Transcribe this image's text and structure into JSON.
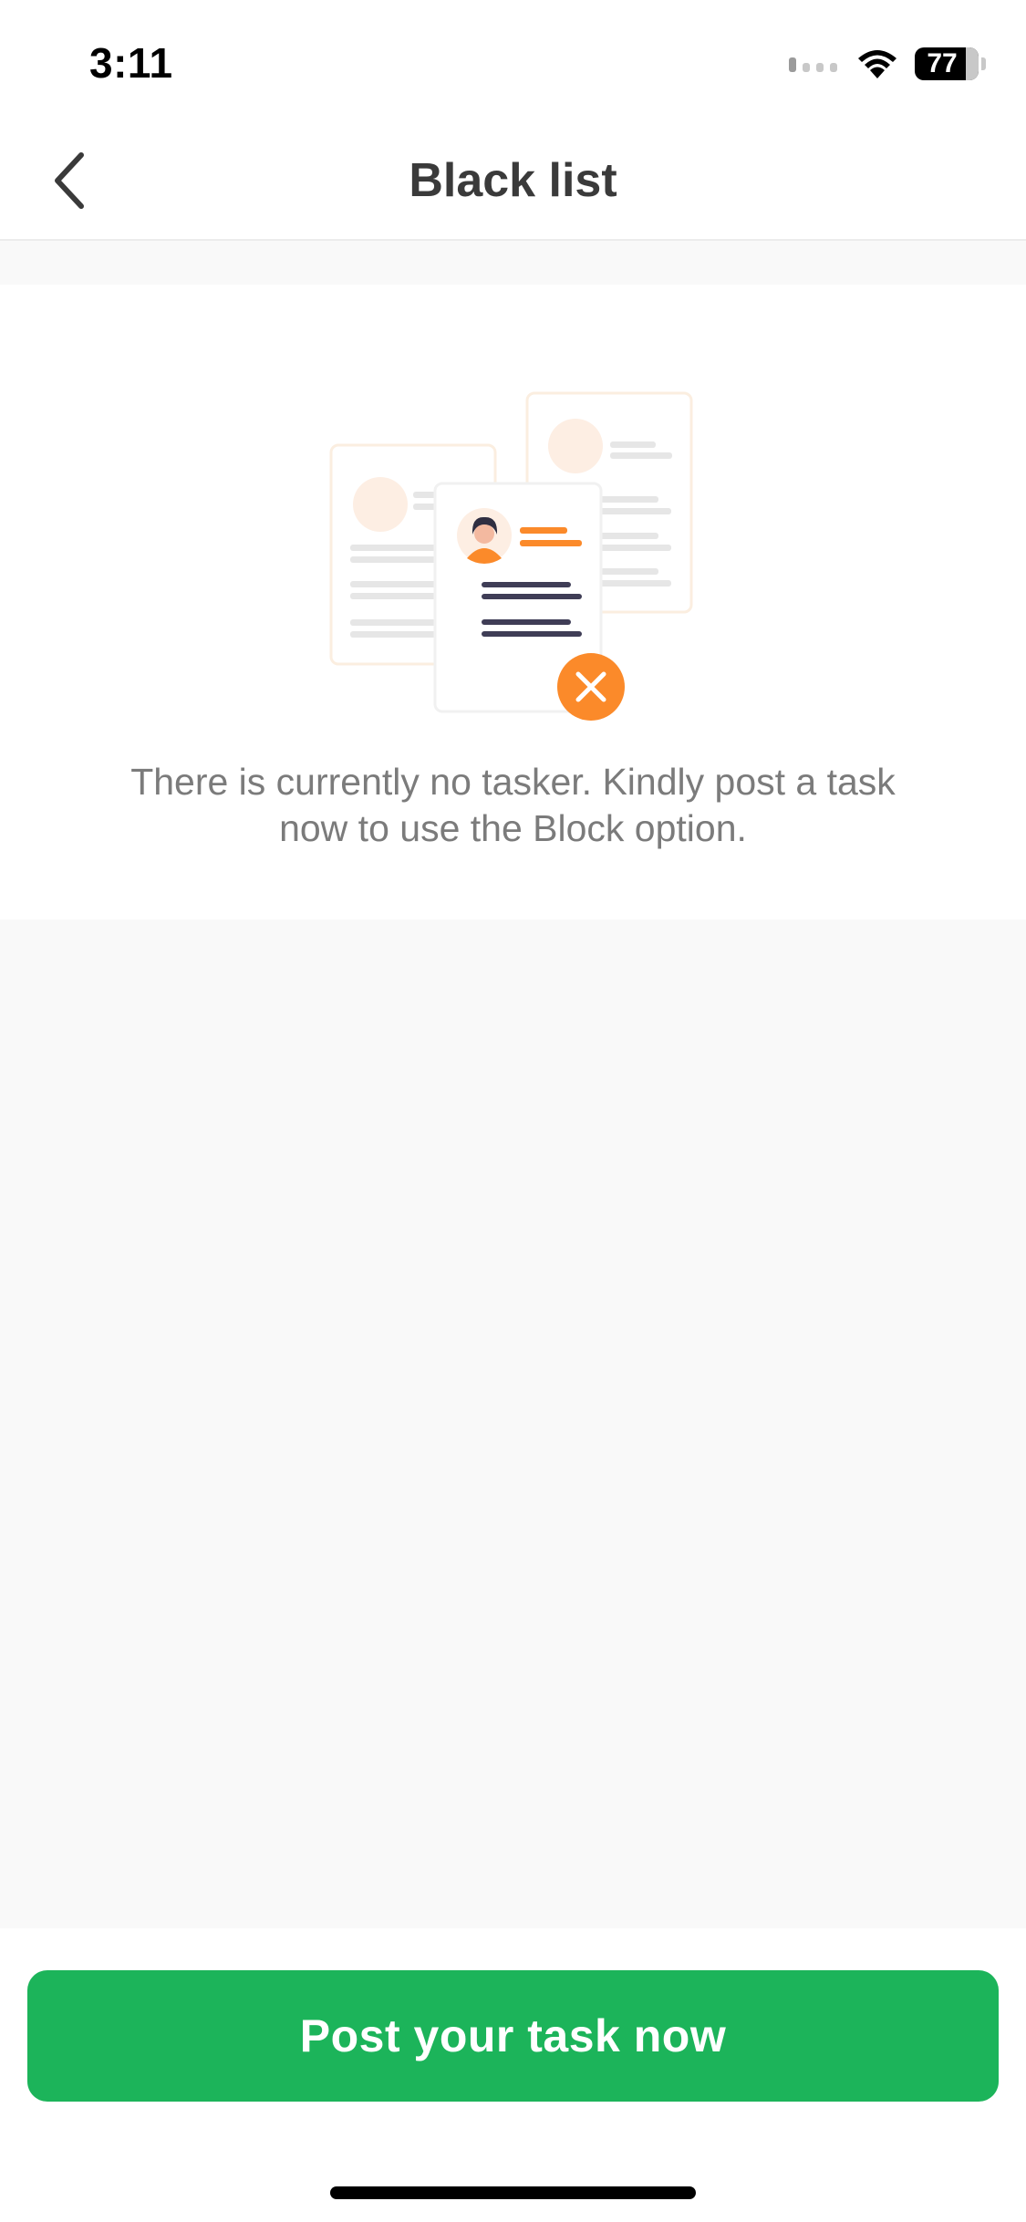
{
  "status_bar": {
    "time": "3:11",
    "battery_level": "77",
    "icons": [
      "signal-icon",
      "wifi-icon",
      "battery-icon"
    ]
  },
  "header": {
    "title": "Black list",
    "back_icon": "chevron-left-icon"
  },
  "empty_state": {
    "illustration": "profile-cards-remove-illustration",
    "message": "There is currently no tasker. Kindly post a task now to use the Block option."
  },
  "actions": {
    "primary_label": "Post your task now"
  },
  "colors": {
    "primary_green": "#1cb45a",
    "accent_orange": "#fb8a2a",
    "text_dark": "#3a3a3a",
    "text_muted": "#7b7b7b",
    "background": "#f9f9f9"
  }
}
